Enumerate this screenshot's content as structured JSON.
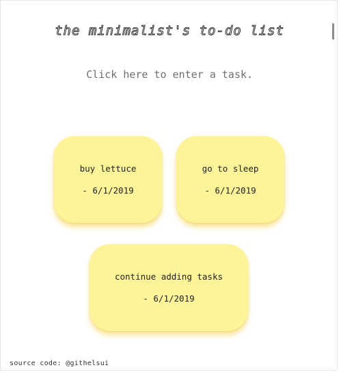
{
  "app": {
    "title": "the minimalist's to-do list"
  },
  "input": {
    "placeholder": "Click here to enter a task.",
    "value": ""
  },
  "tasks": [
    {
      "text": "buy lettuce",
      "date": "- 6/1/2019"
    },
    {
      "text": "go to sleep",
      "date": "- 6/1/2019"
    },
    {
      "text": "continue adding tasks",
      "date": "- 6/1/2019"
    }
  ],
  "footer": {
    "label": "source code: @githelsui"
  },
  "colors": {
    "card_background": "#fdf398",
    "card_shadow": "#f4cc3c",
    "page_background": "#ffffff"
  }
}
